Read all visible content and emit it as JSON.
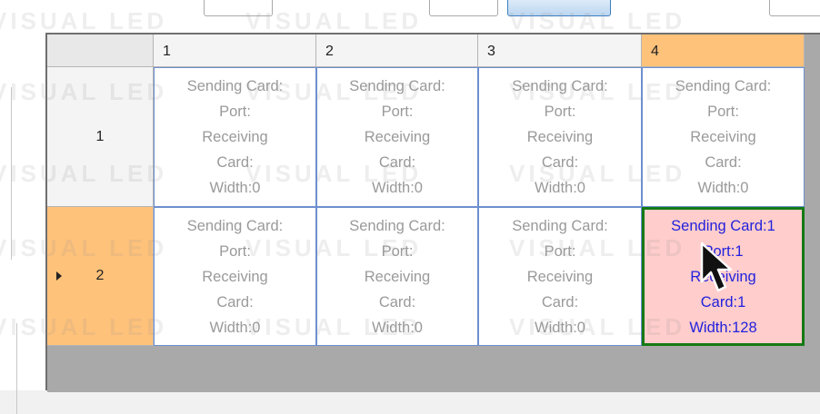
{
  "watermark": "VISUAL LED",
  "columns": [
    "1",
    "2",
    "3",
    "4"
  ],
  "rows": [
    {
      "label": "1",
      "cells": [
        {
          "sending": "Sending Card:",
          "port": "Port:",
          "receiving": "Receiving",
          "card": "Card:",
          "width": "Width:0"
        },
        {
          "sending": "Sending Card:",
          "port": "Port:",
          "receiving": "Receiving",
          "card": "Card:",
          "width": "Width:0"
        },
        {
          "sending": "Sending Card:",
          "port": "Port:",
          "receiving": "Receiving",
          "card": "Card:",
          "width": "Width:0"
        },
        {
          "sending": "Sending Card:",
          "port": "Port:",
          "receiving": "Receiving",
          "card": "Card:",
          "width": "Width:0"
        }
      ]
    },
    {
      "label": "2",
      "cells": [
        {
          "sending": "Sending Card:",
          "port": "Port:",
          "receiving": "Receiving",
          "card": "Card:",
          "width": "Width:0"
        },
        {
          "sending": "Sending Card:",
          "port": "Port:",
          "receiving": "Receiving",
          "card": "Card:",
          "width": "Width:0"
        },
        {
          "sending": "Sending Card:",
          "port": "Port:",
          "receiving": "Receiving",
          "card": "Card:",
          "width": "Width:0"
        },
        {
          "sending": "Sending Card:1",
          "port": "Port:1",
          "receiving": "Receiving",
          "card": "Card:1",
          "width": "Width:128"
        }
      ]
    }
  ],
  "selected": {
    "row": 2,
    "column": 4
  },
  "colors": {
    "header_active": "#ffc27a",
    "selected_cell": "#ffcdcc",
    "selected_border": "#157a15",
    "selected_text": "#2222dd"
  }
}
